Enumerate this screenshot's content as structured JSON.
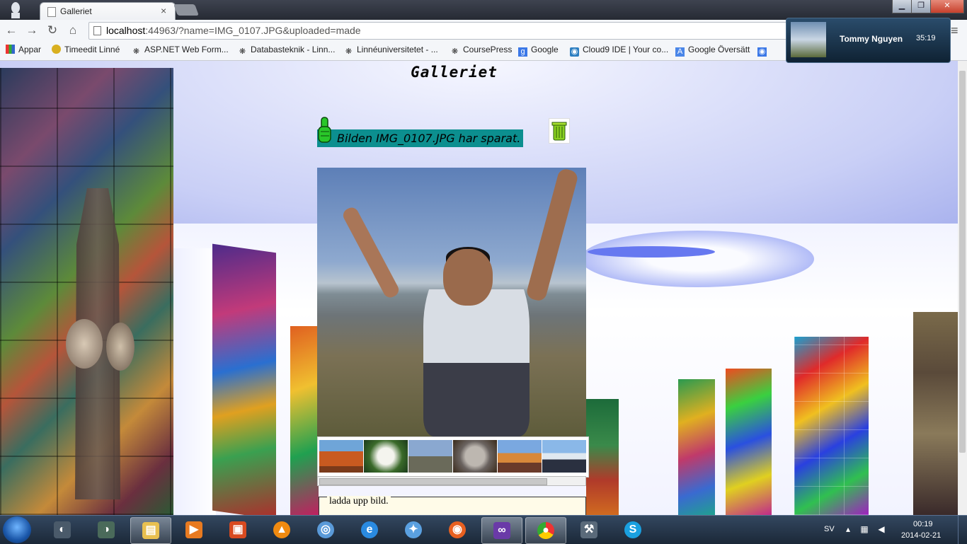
{
  "browser": {
    "tab_title": "Galleriet",
    "tab_close": "×",
    "url_host": "localhost",
    "url_rest": ":44963/?name=IMG_0107.JPG&uploaded=made",
    "window_controls": {
      "minimize": "▁",
      "maximize": "❐",
      "close": "✕"
    }
  },
  "bookmarks": [
    {
      "label": "Appar",
      "icon": "apps-grid-icon"
    },
    {
      "label": "Timeedit Linné",
      "icon": "timeedit-icon"
    },
    {
      "label": "ASP.NET Web Form...",
      "icon": "tree-icon"
    },
    {
      "label": "Databasteknik - Linn...",
      "icon": "tree-icon"
    },
    {
      "label": "Linnéuniversitetet - ...",
      "icon": "tree-icon"
    },
    {
      "label": "CoursePress",
      "icon": "tree-icon"
    },
    {
      "label": "Google",
      "icon": "google-icon"
    },
    {
      "label": "Cloud9 IDE | Your co...",
      "icon": "cloud9-icon"
    },
    {
      "label": "Google Översätt",
      "icon": "translate-icon"
    }
  ],
  "page": {
    "title": "Galleriet",
    "status_message": "Bilden IMG_0107.JPG har sparat.",
    "upload_legend": "ladda upp bild."
  },
  "notification": {
    "name": "Tommy Nguyen",
    "time": "35:19"
  },
  "taskbar": {
    "language": "SV",
    "time": "00:19",
    "date": "2014-02-21",
    "apps": [
      "skype-calls",
      "skype",
      "explorer",
      "media-player",
      "office",
      "vlc",
      "skype-desktop",
      "internet-explorer",
      "safari",
      "firefox",
      "visual-studio",
      "chrome",
      "tools",
      "skype-app"
    ]
  },
  "colors": {
    "status_bg": "#0c8f8f",
    "titlebar": "#2f3440",
    "taskbar": "#1f2d40"
  }
}
